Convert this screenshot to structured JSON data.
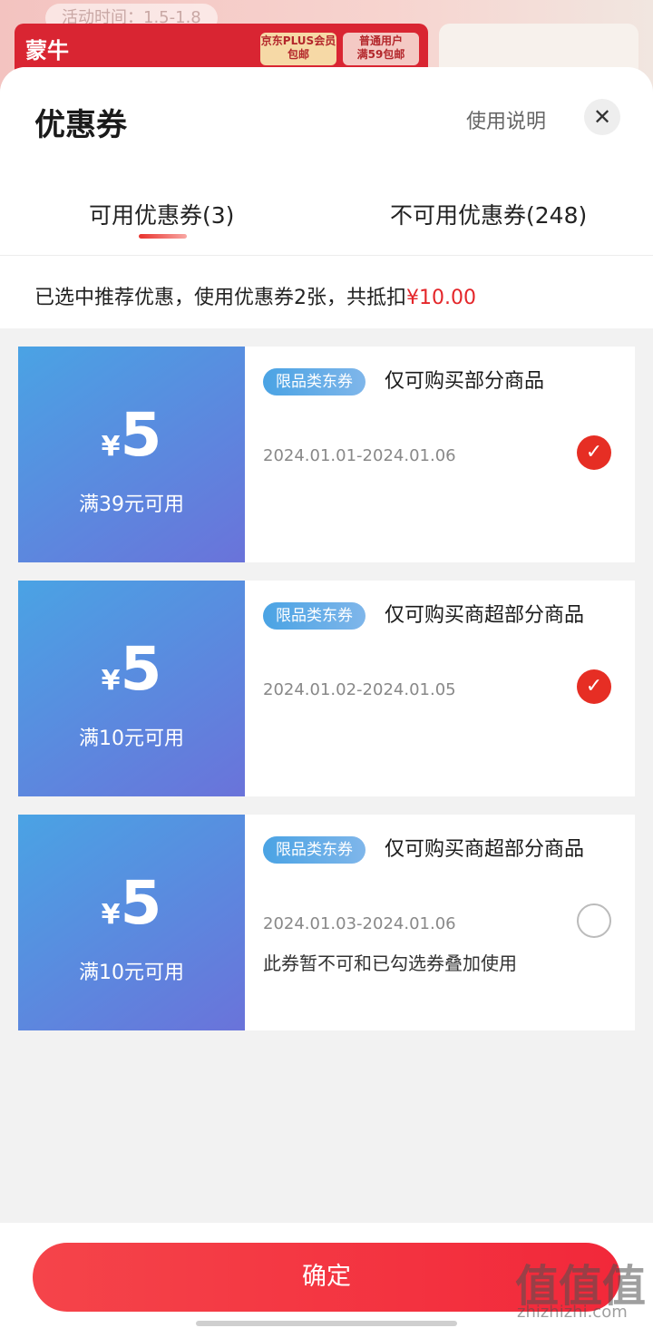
{
  "background": {
    "pill_text": "活动时间：1.5-1.8",
    "brand": "蒙牛",
    "tag_plus": "京东PLUS会员\n包邮",
    "tag_normal": "普通用户\n满59包邮"
  },
  "sheet": {
    "title": "优惠券",
    "help_link": "使用说明",
    "close_icon": "✕",
    "tabs": [
      {
        "label": "可用优惠券(3)",
        "active": true
      },
      {
        "label": "不可用优惠券(248)",
        "active": false
      }
    ],
    "summary_text": "已选中推荐优惠，使用优惠券2张，共抵扣",
    "summary_amount": "¥10.00"
  },
  "coupons": [
    {
      "currency": "¥",
      "amount": "5",
      "condition": "满39元可用",
      "badge": "限品类东券",
      "description": "仅可购买部分商品",
      "date": "2024.01.01-2024.01.06",
      "selected": true,
      "check_icon": "✓",
      "warning": ""
    },
    {
      "currency": "¥",
      "amount": "5",
      "condition": "满10元可用",
      "badge": "限品类东券",
      "description": "仅可购买商超部分商品",
      "date": "2024.01.02-2024.01.05",
      "selected": true,
      "check_icon": "✓",
      "warning": ""
    },
    {
      "currency": "¥",
      "amount": "5",
      "condition": "满10元可用",
      "badge": "限品类东券",
      "description": "仅可购买商超部分商品",
      "date": "2024.01.03-2024.01.06",
      "selected": false,
      "check_icon": "",
      "warning": "此券暂不可和已勾选券叠加使用"
    }
  ],
  "confirm_label": "确定",
  "watermark": {
    "main": "值值值",
    "sub": "zhizhizhi.com"
  },
  "colors": {
    "accent": "#e4262a",
    "coupon_gradient_start": "#4aa3e4",
    "coupon_gradient_end": "#6a73da"
  }
}
